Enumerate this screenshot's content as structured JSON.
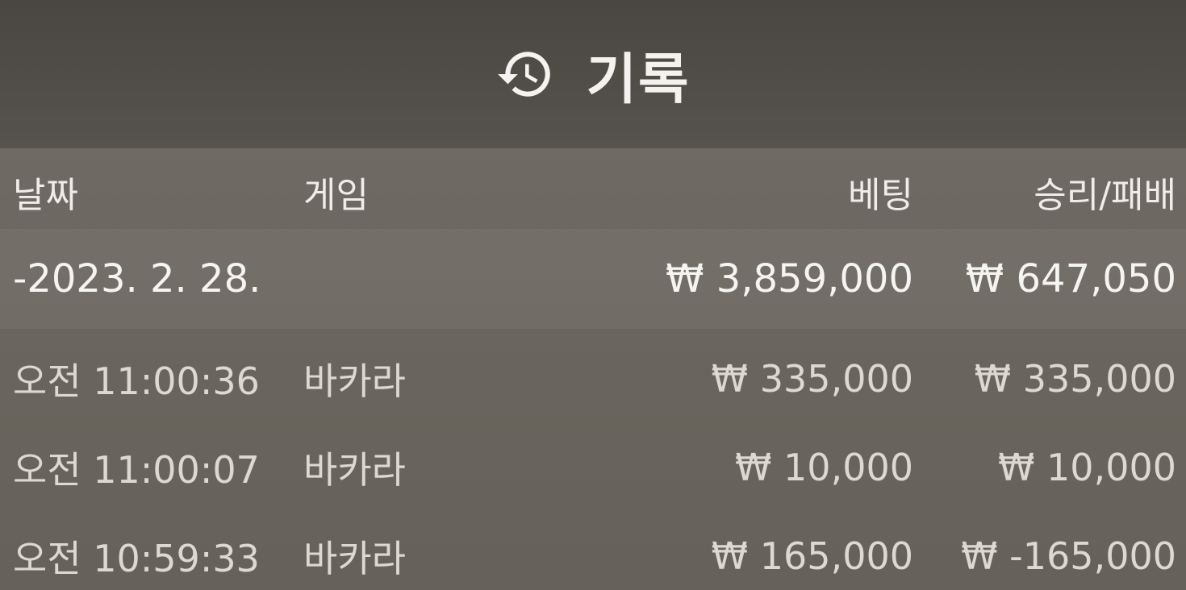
{
  "header": {
    "icon": "history-icon",
    "title": "기록"
  },
  "columns": {
    "date": "날짜",
    "game": "게임",
    "bet": "베팅",
    "win_loss": "승리/패배"
  },
  "date_group": {
    "date": "-2023. 2. 28.",
    "bet_total": "₩ 3,859,000",
    "win_loss_total": "₩ 647,050"
  },
  "rows": [
    {
      "time": "오전 11:00:36",
      "game": "바카라",
      "bet": "₩ 335,000",
      "win_loss": "₩ 335,000"
    },
    {
      "time": "오전 11:00:07",
      "game": "바카라",
      "bet": "₩ 10,000",
      "win_loss": "₩ 10,000"
    },
    {
      "time": "오전 10:59:33",
      "game": "바카라",
      "bet": "₩ 165,000",
      "win_loss": "₩ -165,000"
    }
  ]
}
